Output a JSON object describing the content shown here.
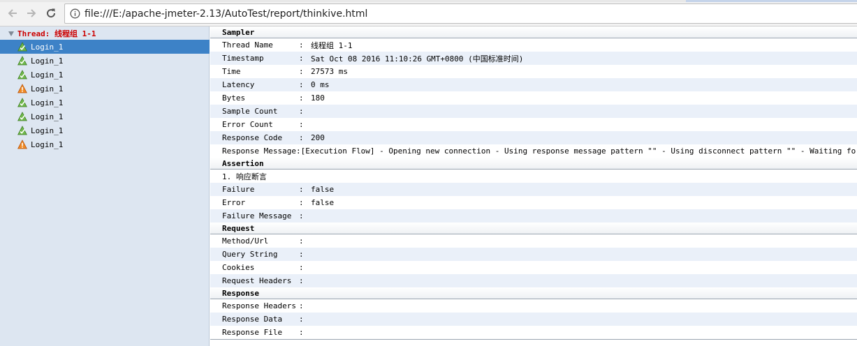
{
  "browser": {
    "url": "file:///E:/apache-jmeter-2.13/AutoTest/report/thinkive.html"
  },
  "tree": {
    "thread_label": "Thread: 线程组 1-1",
    "items": [
      {
        "name": "Login_1",
        "status": "success",
        "selected": true
      },
      {
        "name": "Login_1",
        "status": "success",
        "selected": false
      },
      {
        "name": "Login_1",
        "status": "success",
        "selected": false
      },
      {
        "name": "Login_1",
        "status": "failure",
        "selected": false
      },
      {
        "name": "Login_1",
        "status": "success",
        "selected": false
      },
      {
        "name": "Login_1",
        "status": "success",
        "selected": false
      },
      {
        "name": "Login_1",
        "status": "success",
        "selected": false
      },
      {
        "name": "Login_1",
        "status": "failure",
        "selected": false
      }
    ],
    "success_icon": "green-check-triangle-icon",
    "failure_icon": "orange-warning-triangle-icon"
  },
  "sampler": {
    "heading": "Sampler",
    "rows": [
      {
        "key": "Thread Name",
        "value": "线程组 1-1"
      },
      {
        "key": "Timestamp",
        "value": "Sat Oct 08 2016 11:10:26 GMT+0800 (中国标准时间)"
      },
      {
        "key": "Time",
        "value": "27573 ms"
      },
      {
        "key": "Latency",
        "value": "0 ms"
      },
      {
        "key": "Bytes",
        "value": "180"
      },
      {
        "key": "Sample Count",
        "value": ""
      },
      {
        "key": "Error Count",
        "value": ""
      },
      {
        "key": "Response Code",
        "value": "200"
      },
      {
        "key": "Response Message",
        "value": "[Execution Flow] - Opening new connection - Using response message pattern \"\" - Using disconnect pattern \"\" - Waiting for the server"
      }
    ]
  },
  "assertion": {
    "heading": "Assertion",
    "title": "1. 响应断言",
    "rows": [
      {
        "key": "Failure",
        "value": "false"
      },
      {
        "key": "Error",
        "value": "false"
      },
      {
        "key": "Failure Message",
        "value": ""
      }
    ]
  },
  "request": {
    "heading": "Request",
    "rows": [
      {
        "key": "Method/Url",
        "value": ""
      },
      {
        "key": "Query String",
        "value": ""
      },
      {
        "key": "Cookies",
        "value": ""
      },
      {
        "key": "Request Headers",
        "value": ""
      }
    ]
  },
  "response": {
    "heading": "Response",
    "rows": [
      {
        "key": "Response Headers",
        "value": ""
      },
      {
        "key": "Response Data",
        "value": ""
      },
      {
        "key": "Response File",
        "value": ""
      }
    ]
  },
  "colon": ":",
  "colors": {
    "selected_row": "#3d82c7",
    "alt_row": "#eaf0f9",
    "thread_label": "#cc0000",
    "tree_background": "#dde6f1"
  }
}
